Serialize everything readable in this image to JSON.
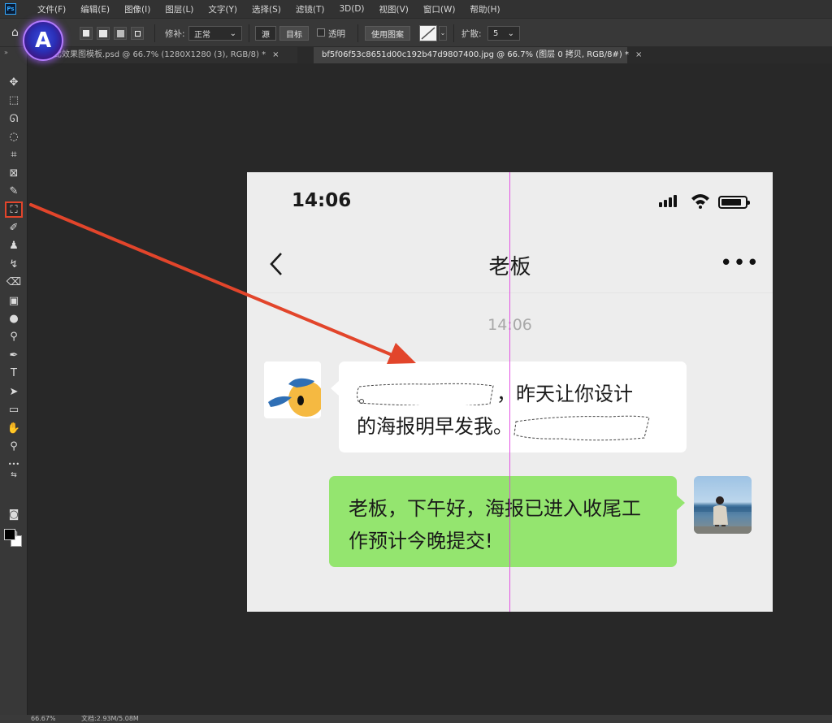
{
  "app": {
    "logo": "Ps"
  },
  "menubar": {
    "items": [
      "文件(F)",
      "编辑(E)",
      "图像(I)",
      "图层(L)",
      "文字(Y)",
      "选择(S)",
      "滤镜(T)",
      "3D(D)",
      "视图(V)",
      "窗口(W)",
      "帮助(H)"
    ]
  },
  "options": {
    "badge_letter": "A",
    "repair_label": "修补:",
    "repair_value": "正常",
    "source_label": "源",
    "target_label": "目标",
    "transparent_label": "透明",
    "use_pattern_label": "使用图案",
    "diffusion_label": "扩散:",
    "diffusion_value": "5"
  },
  "tabs": [
    {
      "label": "对比效果图模板.psd @ 66.7% (1280X1280 (3), RGB/8) *",
      "close": "×"
    },
    {
      "label": "bf5f06f53c8651d00c192b47d9807400.jpg @ 66.7% (图层 0 拷贝, RGB/8#) *",
      "close": "×"
    }
  ],
  "tools": [
    {
      "name": "move-tool",
      "icon": "move-icon",
      "glyph": "✥"
    },
    {
      "name": "marquee-tool",
      "icon": "marquee-icon",
      "glyph": "⬚"
    },
    {
      "name": "lasso-tool",
      "icon": "lasso-icon",
      "glyph": "ᘏ"
    },
    {
      "name": "quick-select-tool",
      "icon": "quick-select-icon",
      "glyph": "◌"
    },
    {
      "name": "crop-tool",
      "icon": "crop-icon",
      "glyph": "⌗"
    },
    {
      "name": "frame-tool",
      "icon": "frame-icon",
      "glyph": "⊠"
    },
    {
      "name": "eyedropper-tool",
      "icon": "eyedropper-icon",
      "glyph": "✎"
    },
    {
      "name": "patch-tool",
      "icon": "patch-icon",
      "glyph": "⛶"
    },
    {
      "name": "brush-tool",
      "icon": "brush-icon",
      "glyph": "✐"
    },
    {
      "name": "stamp-tool",
      "icon": "stamp-icon",
      "glyph": "♟"
    },
    {
      "name": "history-brush-tool",
      "icon": "history-brush-icon",
      "glyph": "↯"
    },
    {
      "name": "eraser-tool",
      "icon": "eraser-icon",
      "glyph": "⌫"
    },
    {
      "name": "gradient-tool",
      "icon": "gradient-icon",
      "glyph": "▣"
    },
    {
      "name": "blur-tool",
      "icon": "blur-icon",
      "glyph": "●"
    },
    {
      "name": "dodge-tool",
      "icon": "dodge-icon",
      "glyph": "⚲"
    },
    {
      "name": "pen-tool",
      "icon": "pen-icon",
      "glyph": "✒"
    },
    {
      "name": "type-tool",
      "icon": "type-icon",
      "glyph": "T"
    },
    {
      "name": "path-select-tool",
      "icon": "path-select-icon",
      "glyph": "➤"
    },
    {
      "name": "shape-tool",
      "icon": "rectangle-icon",
      "glyph": "▭"
    },
    {
      "name": "hand-tool",
      "icon": "hand-icon",
      "glyph": "✋"
    },
    {
      "name": "zoom-tool",
      "icon": "zoom-icon",
      "glyph": "⚲"
    },
    {
      "name": "more-tools",
      "icon": "ellipsis-icon",
      "glyph": "•••"
    }
  ],
  "toolbar_bottom": {
    "swap_glyph": "⇆",
    "mask_glyph": "◙",
    "screen_glyph": "⧉"
  },
  "status": {
    "zoom": "66.67%",
    "doc": "文档:2.93M/5.08M"
  },
  "phone": {
    "time": "14:06",
    "chat_title": "老板",
    "more": "•••",
    "message_time": "14:06",
    "left_message_line1_suffix": "，昨天让你设计",
    "left_message_line2": "的海报明早发我。",
    "right_message": "老板，下午好，海报已进入收尾工作预计今晚提交!"
  },
  "colors": {
    "annotation_red": "#e2452b",
    "guide_magenta": "#e040e0",
    "bubble_green": "#94e56f",
    "ps_blue": "#31a8ff"
  }
}
